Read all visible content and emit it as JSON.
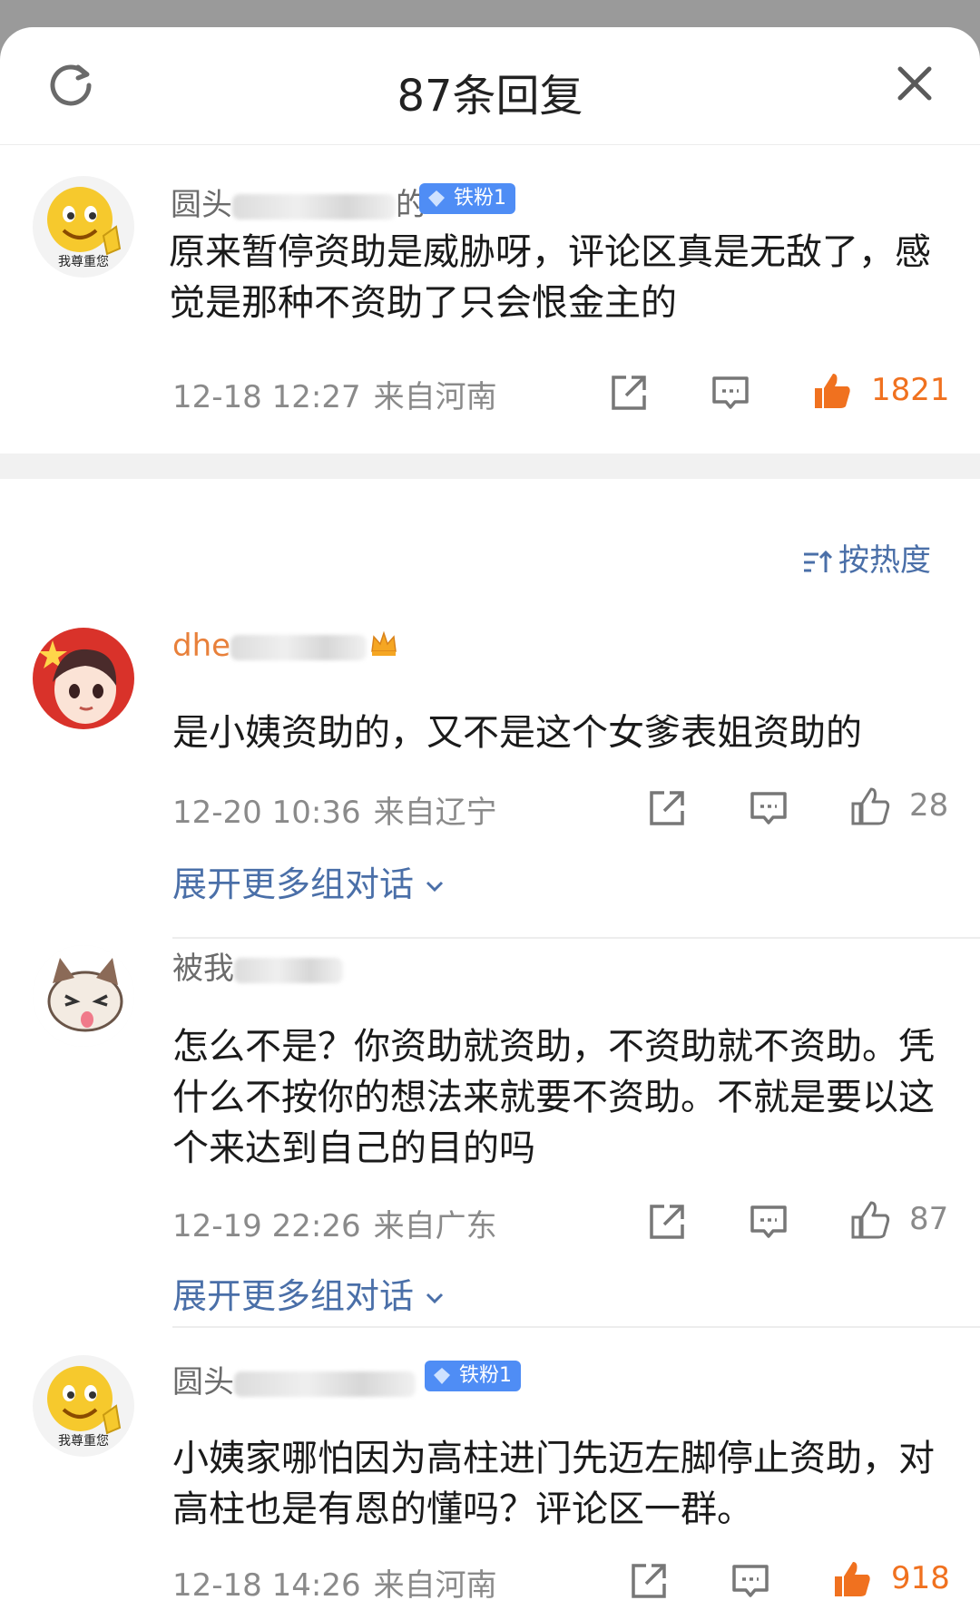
{
  "header": {
    "title": "87条回复"
  },
  "sort_label": "按热度",
  "root_comment": {
    "avatar_caption": "我尊重您",
    "name_visible": "圆头",
    "name_tail": "的",
    "badge": "铁粉1",
    "text": "原来暂停资助是威胁呀，评论区真是无敌了，感觉是那种不资助了只会恨金主的",
    "time": "12-18 12:27",
    "location": "来自河南",
    "likes": "1821"
  },
  "replies": [
    {
      "name_visible": "dhe",
      "text": "是小姨资助的，又不是这个女爹表姐资助的",
      "time": "12-20 10:36",
      "location": "来自辽宁",
      "likes": "28",
      "more": "展开更多组对话"
    },
    {
      "name_visible": "被我",
      "text": "怎么不是？你资助就资助，不资助就不资助。凭什么不按你的想法来就要不资助。不就是要以这个来达到自己的目的吗",
      "time": "12-19 22:26",
      "location": "来自广东",
      "likes": "87",
      "more": "展开更多组对话"
    },
    {
      "name_visible": "圆头",
      "avatar_caption": "我尊重您",
      "badge": "铁粉1",
      "text": "小姨家哪怕因为高柱进门先迈左脚停止资助，对高柱也是有恩的懂吗？评论区一群。",
      "time": "12-18 14:26",
      "location": "来自河南",
      "likes": "918"
    }
  ],
  "colors": {
    "link": "#4a6fa8",
    "like_active": "#f0711f",
    "badge": "#4f8df5",
    "meta": "#8a8a8a"
  },
  "icons": [
    "refresh-icon",
    "close-icon",
    "share-icon",
    "comment-icon",
    "thumbs-up-icon",
    "sort-icon",
    "diamond-icon",
    "chevron-down-icon",
    "crown-icon"
  ]
}
